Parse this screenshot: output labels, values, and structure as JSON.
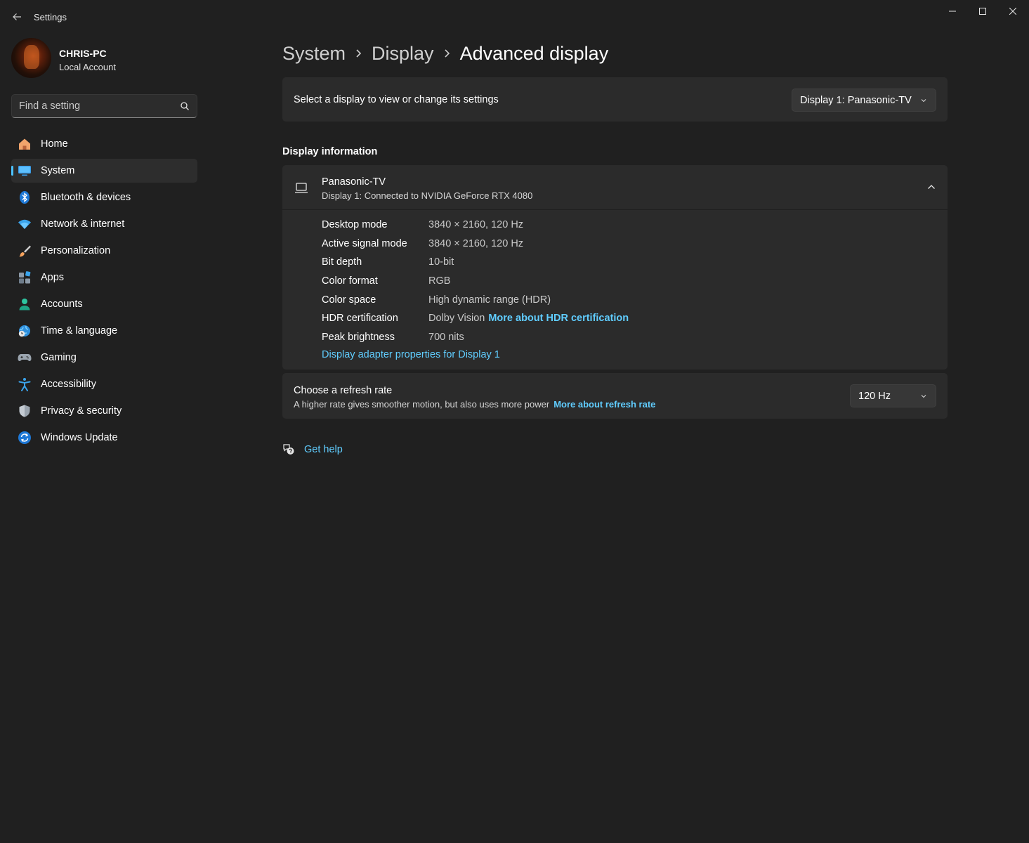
{
  "window": {
    "title": "Settings"
  },
  "user": {
    "name": "CHRIS-PC",
    "account_type": "Local Account"
  },
  "search": {
    "placeholder": "Find a setting"
  },
  "nav": {
    "items": [
      {
        "label": "Home",
        "icon": "home-icon"
      },
      {
        "label": "System",
        "icon": "system-monitor-icon",
        "active": true
      },
      {
        "label": "Bluetooth & devices",
        "icon": "bluetooth-icon"
      },
      {
        "label": "Network & internet",
        "icon": "wifi-icon"
      },
      {
        "label": "Personalization",
        "icon": "brush-icon"
      },
      {
        "label": "Apps",
        "icon": "apps-icon"
      },
      {
        "label": "Accounts",
        "icon": "person-icon"
      },
      {
        "label": "Time & language",
        "icon": "globe-clock-icon"
      },
      {
        "label": "Gaming",
        "icon": "gamepad-icon"
      },
      {
        "label": "Accessibility",
        "icon": "accessibility-icon"
      },
      {
        "label": "Privacy & security",
        "icon": "shield-icon"
      },
      {
        "label": "Windows Update",
        "icon": "sync-icon"
      }
    ]
  },
  "breadcrumb": {
    "items": [
      "System",
      "Display"
    ],
    "current": "Advanced display"
  },
  "display_select": {
    "label": "Select a display to view or change its settings",
    "value": "Display 1: Panasonic-TV"
  },
  "display_info": {
    "section_title": "Display information",
    "name": "Panasonic-TV",
    "subtitle": "Display 1: Connected to NVIDIA GeForce RTX 4080",
    "rows": [
      {
        "key": "Desktop mode",
        "value": "3840 × 2160, 120 Hz"
      },
      {
        "key": "Active signal mode",
        "value": "3840 × 2160, 120 Hz"
      },
      {
        "key": "Bit depth",
        "value": "10-bit"
      },
      {
        "key": "Color format",
        "value": "RGB"
      },
      {
        "key": "Color space",
        "value": "High dynamic range (HDR)"
      },
      {
        "key": "HDR certification",
        "value": "Dolby Vision",
        "link": "More about HDR certification"
      },
      {
        "key": "Peak brightness",
        "value": "700 nits"
      }
    ],
    "adapter_link": "Display adapter properties for Display 1"
  },
  "refresh_rate": {
    "title": "Choose a refresh rate",
    "description": "A higher rate gives smoother motion, but also uses more power",
    "link": "More about refresh rate",
    "value": "120 Hz"
  },
  "help": {
    "label": "Get help"
  },
  "colors": {
    "background": "#202020",
    "card": "#2b2b2b",
    "accent": "#60cdff",
    "nav_indicator": "#4cc2ff"
  }
}
